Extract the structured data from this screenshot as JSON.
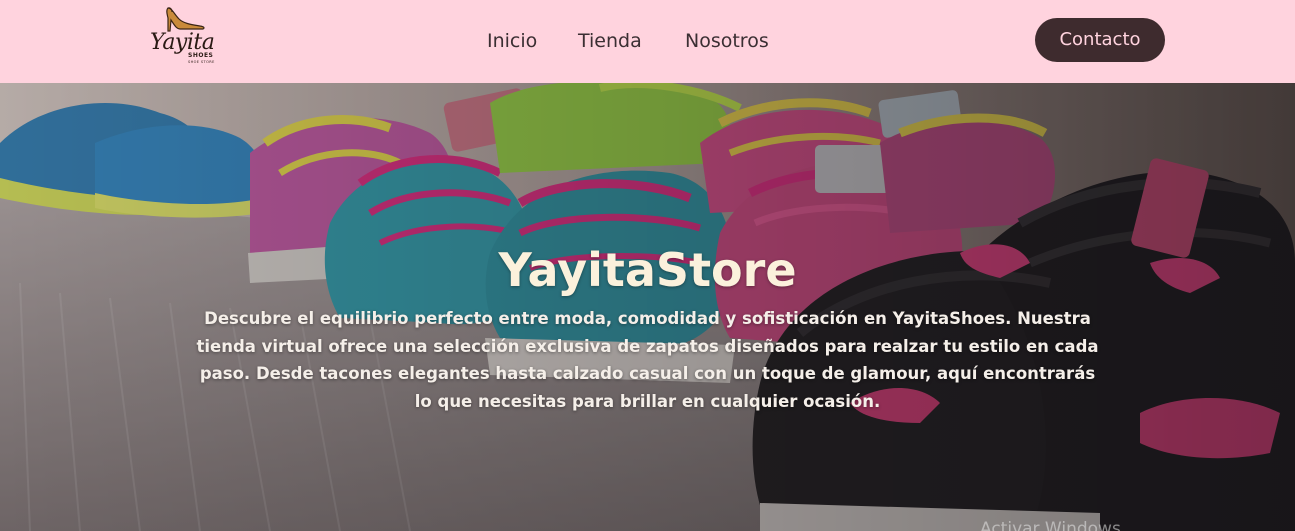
{
  "brand": {
    "logo_text": "Yayita",
    "logo_sub": "SHOES",
    "logo_tagline": "SHOE STORE",
    "logo_icon": "high-heel-shoe-icon"
  },
  "nav": {
    "items": [
      {
        "label": "Inicio"
      },
      {
        "label": "Tienda"
      },
      {
        "label": "Nosotros"
      }
    ],
    "contact_label": "Contacto"
  },
  "hero": {
    "title": "YayitaStore",
    "description": "Descubre el equilibrio perfecto entre moda, comodidad y sofisticación en YayitaShoes. Nuestra tienda virtual ofrece una selección exclusiva de zapatos diseñados para realzar tu estilo en cada paso. Desde tacones elegantes hasta calzado casual con un toque de glamour, aquí encontrarás lo que necesitas para brillar en cualquier ocasión.",
    "background": "sneakers-display-photo"
  },
  "watermark": "Activar Windows",
  "colors": {
    "navbar_bg": "#ffd3de",
    "button_bg": "#3e2b2e",
    "button_text": "#ffd3de",
    "hero_title": "#fbf1dc"
  }
}
